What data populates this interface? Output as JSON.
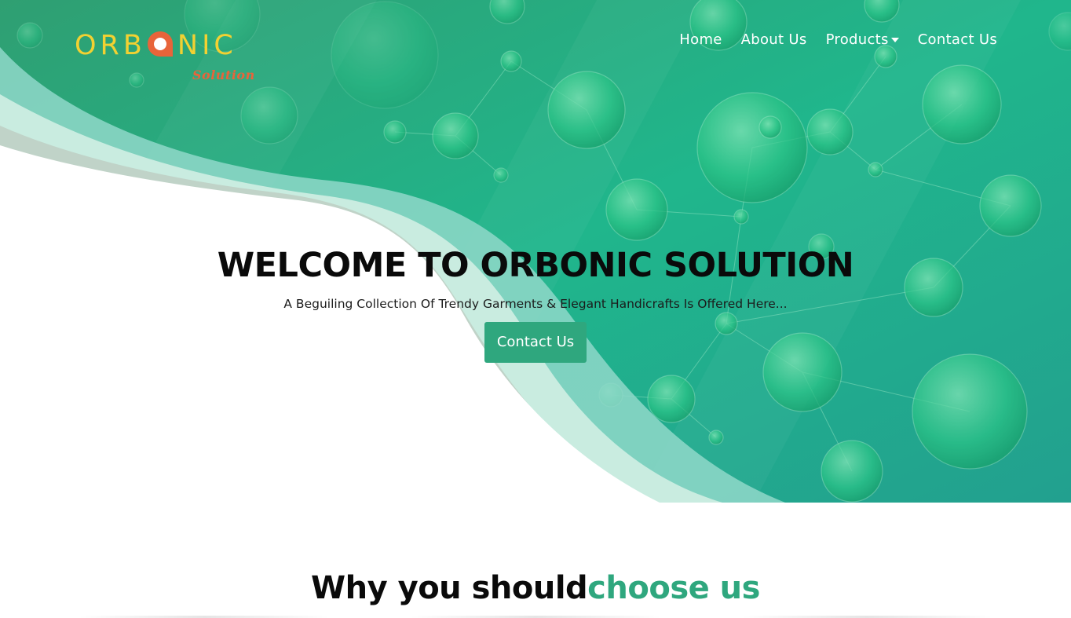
{
  "logo": {
    "word_left": "ORB",
    "word_right": "NIC",
    "subtitle": "Solution",
    "colors": {
      "letters": "#f2d132",
      "mark": "#e8643a",
      "subtitle": "#e8643a"
    }
  },
  "nav": {
    "items": [
      {
        "label": "Home"
      },
      {
        "label": "About Us"
      },
      {
        "label": "Products",
        "has_dropdown": true
      },
      {
        "label": "Contact Us"
      }
    ]
  },
  "hero": {
    "title": "WELCOME TO ORBONIC SOLUTION",
    "subtitle": "A Beguiling Collection Of Trendy Garments & Elegant Handicrafts Is Offered Here...",
    "button_label": "Contact Us",
    "background_icon": "green-molecule-bubbles"
  },
  "why": {
    "heading_dark": "Why you should",
    "heading_accent": "choose us"
  },
  "colors": {
    "accent": "#2fa77e",
    "hero_green": "#22b48a",
    "text_dark": "#0a0a0a"
  }
}
